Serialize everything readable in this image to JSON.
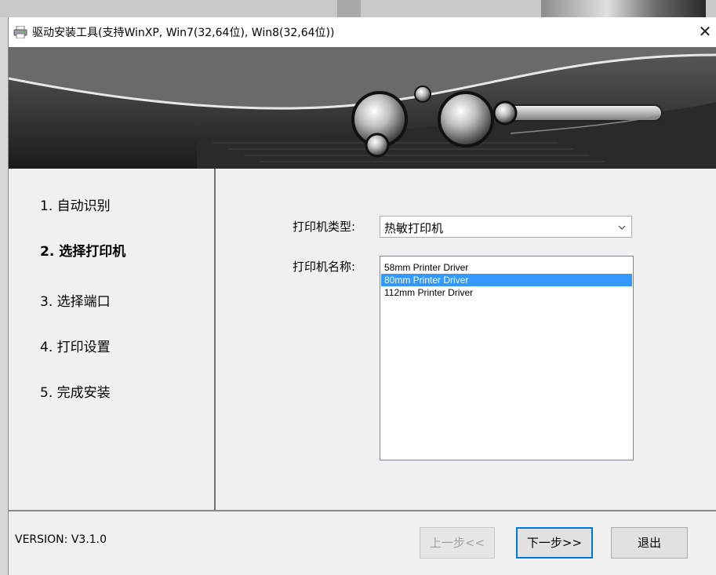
{
  "window": {
    "title": "驱动安装工具(支持WinXP, Win7(32,64位), Win8(32,64位))",
    "close_glyph": "✕"
  },
  "steps": [
    {
      "label": "1. 自动识别",
      "active": false
    },
    {
      "label": "2. 选择打印机",
      "active": true
    },
    {
      "label": "3. 选择端口",
      "active": false
    },
    {
      "label": "4. 打印设置",
      "active": false
    },
    {
      "label": "5. 完成安装",
      "active": false
    }
  ],
  "form": {
    "type_label": "打印机类型:",
    "type_value": "热敏打印机",
    "name_label": "打印机名称:",
    "printers": [
      {
        "name": "58mm Printer Driver",
        "selected": false
      },
      {
        "name": "80mm Printer Driver",
        "selected": true
      },
      {
        "name": "112mm Printer Driver",
        "selected": false
      }
    ]
  },
  "footer": {
    "version": "VERSION: V3.1.0",
    "prev_label": "上一步<<",
    "next_label": "下一步>>",
    "exit_label": "退出"
  },
  "icons": {
    "app": "printer-icon",
    "close": "close-icon",
    "dropdown": "chevron-down-icon"
  },
  "colors": {
    "selection": "#3399ff",
    "default_button_border": "#0078d7"
  }
}
